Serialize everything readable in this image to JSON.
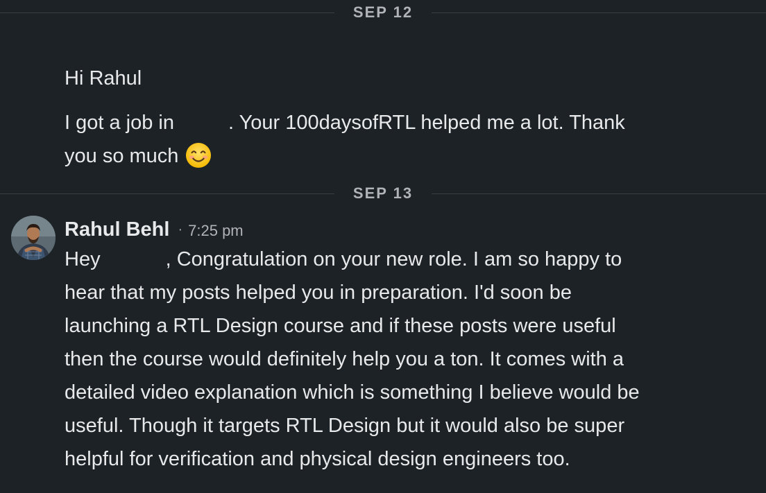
{
  "conversation": {
    "dividers": [
      {
        "date": "SEP 12"
      },
      {
        "date": "SEP 13"
      }
    ],
    "message1": {
      "line1": "Hi Rahul",
      "line2_part1": "I got a job in",
      "line2_part2": ". Your 100daysofRTL helped me a lot. Thank",
      "line3": "you so much",
      "emoji_icon": "smiling-face-emoji"
    },
    "message2": {
      "sender": "Rahul Behl",
      "separator": "·",
      "time": "7:25 pm",
      "line1_part1": "Hey",
      "line1_part2": ", Congratulation on your new role. I am so happy to",
      "line2": "hear that my posts helped you in preparation. I'd soon be",
      "line3": "launching a RTL Design course and if these posts were useful",
      "line4": "then the course would definitely help you a ton. It comes with a",
      "line5": "detailed video explanation which is something I believe would be",
      "line6": "useful. Though it targets RTL Design but it would also be super",
      "line7": "helpful for verification and physical design engineers too."
    }
  },
  "colors": {
    "background": "#1d2226",
    "text": "#e8e9ea",
    "muted": "#b0b4b8",
    "divider": "#3a3f44"
  }
}
